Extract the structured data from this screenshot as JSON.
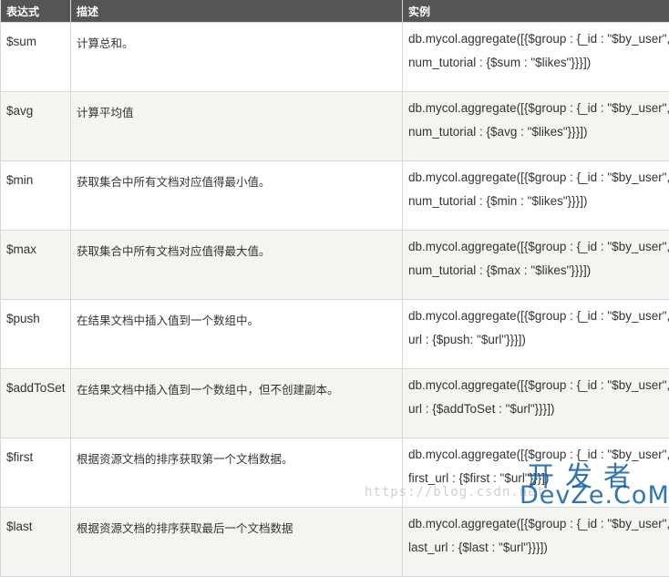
{
  "table": {
    "headers": [
      "表达式",
      "描述",
      "实例"
    ],
    "rows": [
      {
        "expr": "$sum",
        "desc": "计算总和。",
        "ex1": "db.mycol.aggregate([{$group : {_id : \"$by_user\",",
        "ex2": "num_tutorial : {$sum : \"$likes\"}}}])"
      },
      {
        "expr": "$avg",
        "desc": "计算平均值",
        "ex1": "db.mycol.aggregate([{$group : {_id : \"$by_user\",",
        "ex2": "num_tutorial : {$avg : \"$likes\"}}}])"
      },
      {
        "expr": "$min",
        "desc": "获取集合中所有文档对应值得最小值。",
        "ex1": "db.mycol.aggregate([{$group : {_id : \"$by_user\",",
        "ex2": "num_tutorial : {$min : \"$likes\"}}}])"
      },
      {
        "expr": "$max",
        "desc": "获取集合中所有文档对应值得最大值。",
        "ex1": "db.mycol.aggregate([{$group : {_id : \"$by_user\",",
        "ex2": "num_tutorial : {$max : \"$likes\"}}}])"
      },
      {
        "expr": "$push",
        "desc": "在结果文档中插入值到一个数组中。",
        "ex1": "db.mycol.aggregate([{$group : {_id : \"$by_user\",",
        "ex2": "url : {$push: \"$url\"}}}])"
      },
      {
        "expr": "$addToSet",
        "desc": "在结果文档中插入值到一个数组中，但不创建副本。",
        "ex1": "db.mycol.aggregate([{$group : {_id : \"$by_user\",",
        "ex2": "url : {$addToSet : \"$url\"}}}])"
      },
      {
        "expr": "$first",
        "desc": "根据资源文档的排序获取第一个文档数据。",
        "ex1": "db.mycol.aggregate([{$group : {_id : \"$by_user\",",
        "ex2": "first_url : {$first : \"$url\"}}}])"
      },
      {
        "expr": "$last",
        "desc": "根据资源文档的排序获取最后一个文档数据",
        "ex1": "db.mycol.aggregate([{$group : {_id : \"$by_user\",",
        "ex2": "last_url : {$last : \"$url\"}}}])"
      }
    ]
  },
  "watermark": {
    "url_text": "https://blog.csdn.net",
    "logo_cn": "开发者",
    "logo_en": "DevZe.CoM"
  }
}
